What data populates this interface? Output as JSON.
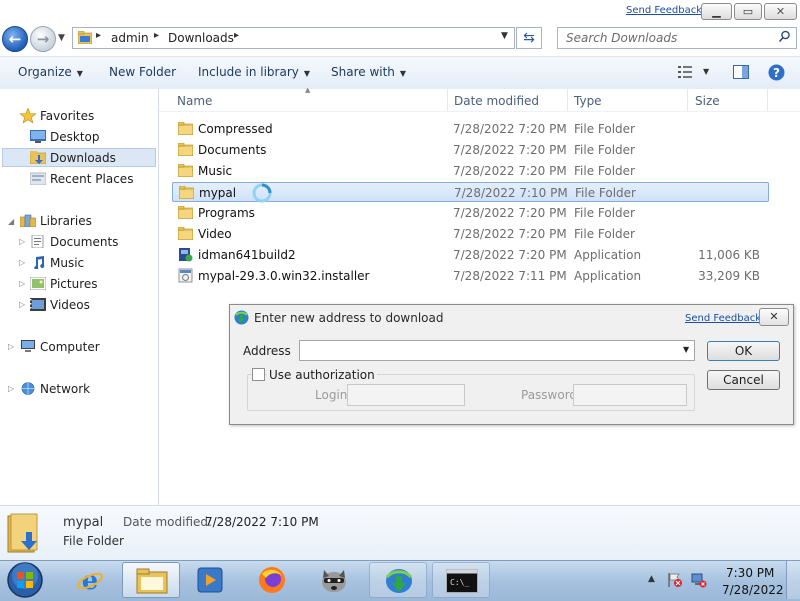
{
  "window": {
    "send_feedback": "Send Feedback",
    "minimize_icon": "minimize-icon",
    "maximize_icon": "maximize-icon",
    "close_label": "✕"
  },
  "address": {
    "crumbs": [
      "admin",
      "Downloads"
    ],
    "search_placeholder": "Search Downloads"
  },
  "toolbar": {
    "organize": "Organize",
    "new_folder": "New Folder",
    "include_in_library": "Include in library",
    "share_with": "Share with"
  },
  "navigation": {
    "favorites_label": "Favorites",
    "favorites": [
      "Desktop",
      "Downloads",
      "Recent Places"
    ],
    "libraries_label": "Libraries",
    "libraries": [
      "Documents",
      "Music",
      "Pictures",
      "Videos"
    ],
    "computer": "Computer",
    "network": "Network",
    "selected": "Downloads"
  },
  "columns": {
    "name": "Name",
    "date_modified": "Date modified",
    "type": "Type",
    "size": "Size"
  },
  "files": [
    {
      "name": "Compressed",
      "date": "7/28/2022 7:20 PM",
      "type": "File Folder",
      "size": "",
      "icon": "folder-icon"
    },
    {
      "name": "Documents",
      "date": "7/28/2022 7:20 PM",
      "type": "File Folder",
      "size": "",
      "icon": "folder-icon"
    },
    {
      "name": "Music",
      "date": "7/28/2022 7:20 PM",
      "type": "File Folder",
      "size": "",
      "icon": "folder-icon"
    },
    {
      "name": "mypal",
      "date": "7/28/2022 7:10 PM",
      "type": "File Folder",
      "size": "",
      "icon": "folder-icon"
    },
    {
      "name": "Programs",
      "date": "7/28/2022 7:20 PM",
      "type": "File Folder",
      "size": "",
      "icon": "folder-icon"
    },
    {
      "name": "Video",
      "date": "7/28/2022 7:20 PM",
      "type": "File Folder",
      "size": "",
      "icon": "folder-icon"
    },
    {
      "name": "idman641build2",
      "date": "7/28/2022 7:20 PM",
      "type": "Application",
      "size": "11,006 KB",
      "icon": "installer-icon"
    },
    {
      "name": "mypal-29.3.0.win32.installer",
      "date": "7/28/2022 7:11 PM",
      "type": "Application",
      "size": "33,209 KB",
      "icon": "application-icon"
    }
  ],
  "selected_file": "mypal",
  "dialog": {
    "title": "Enter new address to download",
    "send_feedback": "Send Feedback",
    "address_label": "Address",
    "address_value": "",
    "ok": "OK",
    "cancel": "Cancel",
    "use_authorization": "Use authorization",
    "login_label": "Login",
    "password_label": "Password"
  },
  "details": {
    "name": "mypal",
    "date_modified_label": "Date modified:",
    "date_modified": "7/28/2022 7:10 PM",
    "type": "File Folder"
  },
  "taskbar": {
    "apps": [
      "start-orb-icon",
      "internet-explorer-icon",
      "windows-explorer-icon",
      "media-player-icon",
      "firefox-icon",
      "raccoon-app-icon",
      "internet-download-manager-icon",
      "command-prompt-icon"
    ],
    "time": "7:30 PM",
    "date": "7/28/2022"
  },
  "colors": {
    "selection": "#cfe2fa",
    "selection_border": "#84acdd",
    "link": "#1a4ea8",
    "taskbar": "#a7c2df"
  }
}
